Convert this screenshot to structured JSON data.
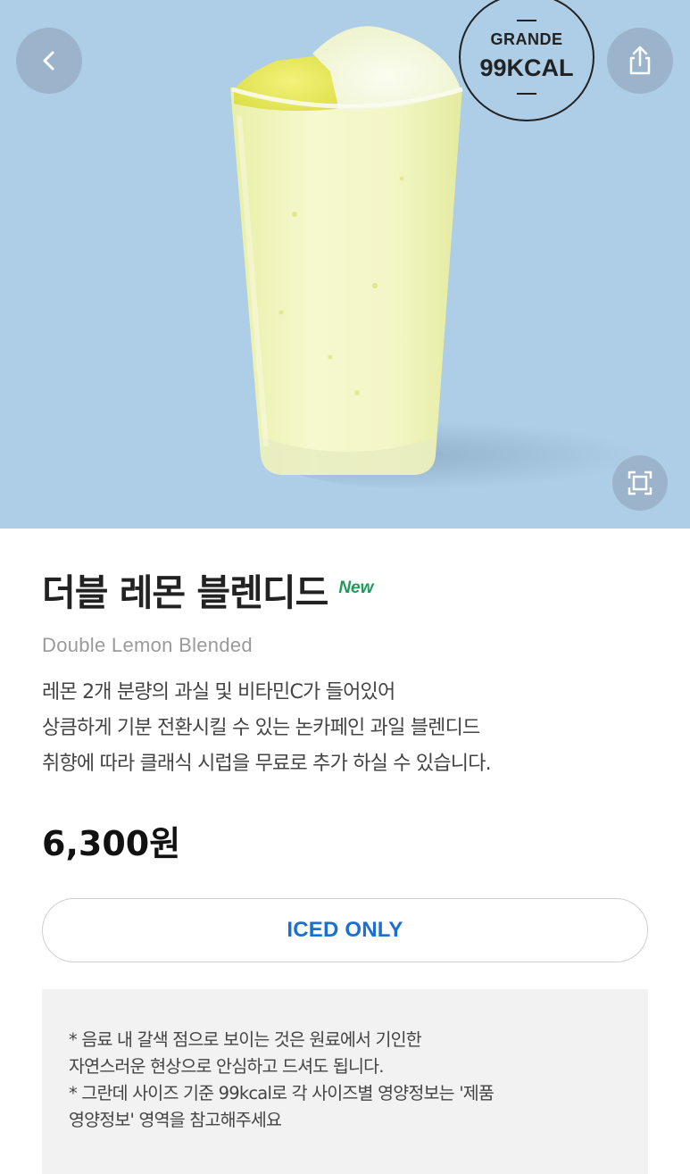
{
  "hero": {
    "background_color": "#aecde6",
    "kcal_badge": {
      "size": "GRANDE",
      "value": "99KCAL"
    },
    "icons": {
      "back": "chevron-left-icon",
      "share": "share-icon",
      "expand": "expand-icon"
    }
  },
  "product": {
    "name_ko": "더블 레몬 블렌디드",
    "new_tag": "New",
    "name_en": "Double Lemon Blended",
    "description": [
      "레몬 2개 분량의 과실 및 비타민C가 들어있어",
      "상큼하게 기분 전환시킬 수 있는 논카페인 과일 블렌디드",
      "취향에 따라 클래식 시럽을 무료로 추가 하실 수 있습니다."
    ],
    "price": "6,300원",
    "temperature_option": "ICED ONLY",
    "notice": [
      "* 음료 내 갈색 점으로 보이는 것은 원료에서 기인한",
      "자연스러운 현상으로 안심하고 드셔도 됩니다.",
      "* 그란데 사이즈 기준 99kcal로 각 사이즈별 영양정보는 '제품",
      "영양정보' 영역을 참고해주세요"
    ]
  },
  "colors": {
    "accent_blue": "#1a6fd1",
    "new_green": "#1f9a5a"
  }
}
